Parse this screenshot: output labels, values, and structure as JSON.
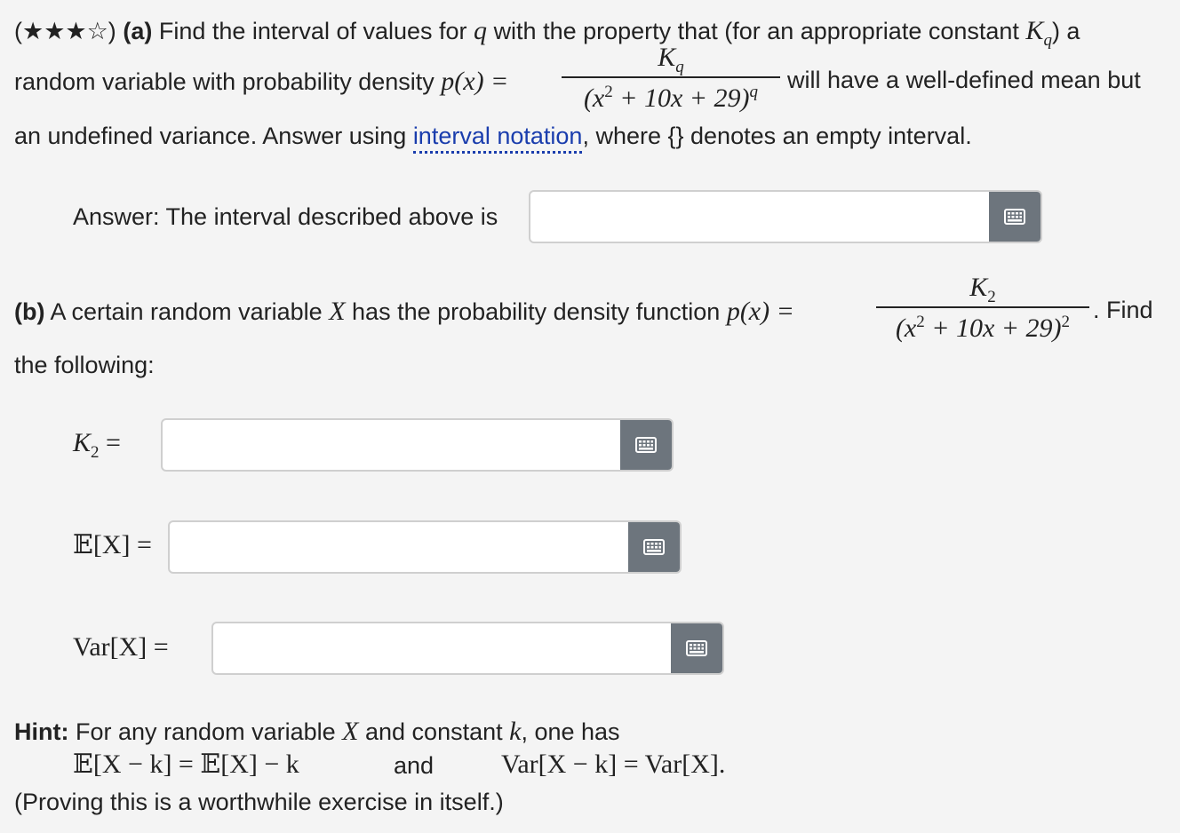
{
  "part_a": {
    "stars": "(★★★☆)",
    "label": "(a)",
    "line1_text": "Find the interval of values for",
    "var_q": "q",
    "line1_text2": "with the property that (for an appropriate constant",
    "const_K": "K",
    "const_sub": "q",
    "line1_end": ") a",
    "line2_text": "random variable with probability density",
    "px": "p(x) =",
    "frac_num": "K",
    "frac_num_sub": "q",
    "frac_den_pre": "(x",
    "frac_den_exp": "2",
    "frac_den_mid": " + 10x + 29)",
    "frac_den_pow": "q",
    "line2_end": "will have a well-defined mean but",
    "line3_pre": "an undefined variance. Answer using",
    "link_text": "interval notation",
    "line3_end": ", where {} denotes an empty interval.",
    "answer_label": "Answer: The interval described above is",
    "answer_value": ""
  },
  "part_b": {
    "label": "(b)",
    "text": "A certain random variable",
    "var_X": "X",
    "text2": "has the probability density function",
    "px": "p(x) =",
    "frac_num": "K",
    "frac_num_sub": "2",
    "frac_den_pre": "(x",
    "frac_den_exp": "2",
    "frac_den_mid": " + 10x + 29)",
    "frac_den_pow": "2",
    "end": ". Find",
    "line2": "the following:",
    "fields": [
      {
        "label": "K",
        "sub": "2",
        "eq": "=",
        "value": ""
      },
      {
        "label": "𝔼[X]",
        "eq": "=",
        "value": ""
      },
      {
        "label": "Var[X]",
        "eq": "=",
        "value": ""
      }
    ]
  },
  "hint": {
    "label": "Hint:",
    "text": "For any random variable",
    "var_X": "X",
    "text2": "and constant",
    "var_k": "k",
    "text3": ", one has",
    "formula1": "𝔼[X − k] = 𝔼[X] − k",
    "and": "and",
    "formula2": "Var[X − k] = Var[X].",
    "note": "(Proving this is a worthwhile exercise in itself.)"
  },
  "icons": {
    "keypad": "keyboard-grid-icon"
  },
  "colors": {
    "button": "#6d757d",
    "link": "#1a3dad",
    "background": "#f4f4f4"
  }
}
